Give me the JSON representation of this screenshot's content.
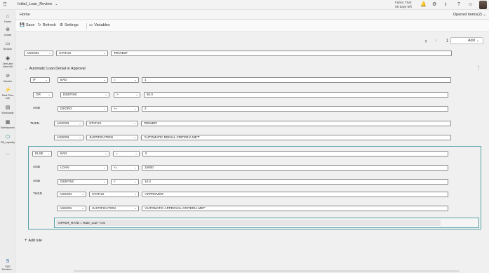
{
  "app": {
    "title": "Initial_Loan_Review",
    "trial_line1": "Fabric Trial:",
    "trial_line2": "55 days left"
  },
  "topbar_icons": [
    "grid-icon",
    "bell-icon",
    "gear-icon",
    "download-icon",
    "help-icon",
    "people-icon"
  ],
  "rail": [
    {
      "label": "Home",
      "icon": "home-icon"
    },
    {
      "label": "Create",
      "icon": "plus-circle-icon"
    },
    {
      "label": "Browse",
      "icon": "folder-icon"
    },
    {
      "label": "OneLake data hub",
      "icon": "onelake-icon"
    },
    {
      "label": "Monitor",
      "icon": "monitor-icon"
    },
    {
      "label": "Real-Time hub",
      "icon": "realtime-icon"
    },
    {
      "label": "Workloads",
      "icon": "workloads-icon"
    },
    {
      "label": "Workspaces",
      "icon": "workspaces-icon"
    },
    {
      "label": "DB_capacity",
      "icon": "capacity-icon"
    },
    {
      "label": "...",
      "icon": "more-icon"
    },
    {
      "label": "SAS Decision...",
      "icon": "sas-icon"
    }
  ],
  "home_tab": "Home",
  "opened_items": "Opened items(2)",
  "toolbar": {
    "save": "Save",
    "refresh": "Refresh",
    "settings": "Settings",
    "variables": "Variables"
  },
  "add_button": "Add",
  "top_assign": {
    "action": "ASSIGN",
    "var": "STATUS",
    "value": "'REVIEW'"
  },
  "rule": {
    "title": "Automatic Loan Denial or Approval",
    "if_block": [
      {
        "kw": "IF",
        "var": "BAD",
        "op": "=",
        "value": "1"
      },
      {
        "kw": "OR",
        "var": "DEBTINC",
        "op": ">",
        "value": "50.0"
      },
      {
        "kw": "AND",
        "var": "DEORG",
        "op": ">=",
        "value": "2"
      }
    ],
    "then_block": [
      {
        "kw": "THEN",
        "action": "ASSIGN",
        "var": "STATUS",
        "value": "'DENIED'"
      },
      {
        "kw": "",
        "action": "ASSIGN",
        "var": "JUSTIFICATION",
        "value": "'AUTOMATIC DENIAL CRITERIA MET'"
      }
    ],
    "else_block": [
      {
        "kw": "ELSE",
        "var": "BAD",
        "op": "=",
        "value": "0"
      },
      {
        "kw": "AND",
        "var": "LOAN",
        "op": "<=",
        "value": "15000"
      },
      {
        "kw": "AND",
        "var": "DEBTINC",
        "op": "<",
        "value": "10.0"
      }
    ],
    "else_then_block": [
      {
        "kw": "THEN",
        "action": "ASSIGN",
        "var": "STATUS",
        "value": "'APPROVED'"
      },
      {
        "kw": "",
        "action": "ASSIGN",
        "var": "JUSTIFICATION",
        "value": "'AUTOMATIC APPROVAL CRITERIA MET'"
      }
    ],
    "expression": "OFFER_RATE = Rate_Low * 0.5"
  },
  "add_rule": "Add rule"
}
